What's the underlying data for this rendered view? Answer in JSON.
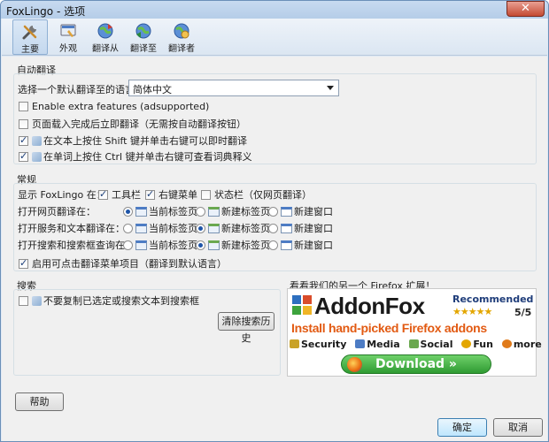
{
  "window": {
    "title": "FoxLingo - 选项",
    "close_label": "✕"
  },
  "toolbar": {
    "tabs": [
      {
        "label": "主要",
        "icon": "tools-icon"
      },
      {
        "label": "外观",
        "icon": "appearance-icon"
      },
      {
        "label": "翻译从",
        "icon": "translate-from-icon"
      },
      {
        "label": "翻译至",
        "icon": "translate-to-icon"
      },
      {
        "label": "翻译者",
        "icon": "translators-icon"
      }
    ]
  },
  "auto": {
    "group_label": "自动翻译",
    "default_lang_label": "选择一个默认翻译至的语言：",
    "default_lang_value": "简体中文",
    "opt1": "Enable extra features (adsupported)",
    "opt2": "页面载入完成后立即翻译（无需按自动翻译按钮）",
    "opt3": "在文本上按住 Shift 键并单击右键可以即时翻译",
    "opt4": "在单词上按住 Ctrl 键并单击右键可查看词典释义"
  },
  "general": {
    "group_label": "常规",
    "show_in_label": "显示 FoxLingo 在：",
    "show_toolbar": "工具栏",
    "show_context": "右键菜单",
    "show_status": "状态栏（仅网页翻译）",
    "rows": [
      {
        "label": "打开网页翻译在：",
        "selected": 0
      },
      {
        "label": "打开服务和文本翻译在：",
        "selected": 1
      },
      {
        "label": "打开搜索和搜索框查询在：",
        "selected": 1
      }
    ],
    "opt_current": "当前标签页",
    "opt_newtab": "新建标签页",
    "opt_newwin": "新建窗口",
    "enable_click": "启用可点击翻译菜单项目（翻译到默认语言）"
  },
  "search": {
    "group_label": "搜索",
    "no_copy": "不要复制已选定或搜索文本到搜索框",
    "clear_history": "清除搜索历史"
  },
  "promo": {
    "heading": "看看我们的另一个 Firefox 扩展！",
    "name": "AddonFox",
    "recommended": "Recommended",
    "stars": "★★★★★",
    "score": "5/5",
    "tagline": "Install hand-picked Firefox addons",
    "cats": [
      "Security",
      "Media",
      "Social",
      "Fun",
      "more"
    ],
    "download": "Download »"
  },
  "footer": {
    "help": "帮助",
    "ok": "确定",
    "cancel": "取消"
  },
  "colors": {
    "accent": "#1f55a8",
    "titlebar": "#c7daf0",
    "promo_orange": "#e25a12",
    "download_green": "#2f9b32"
  }
}
